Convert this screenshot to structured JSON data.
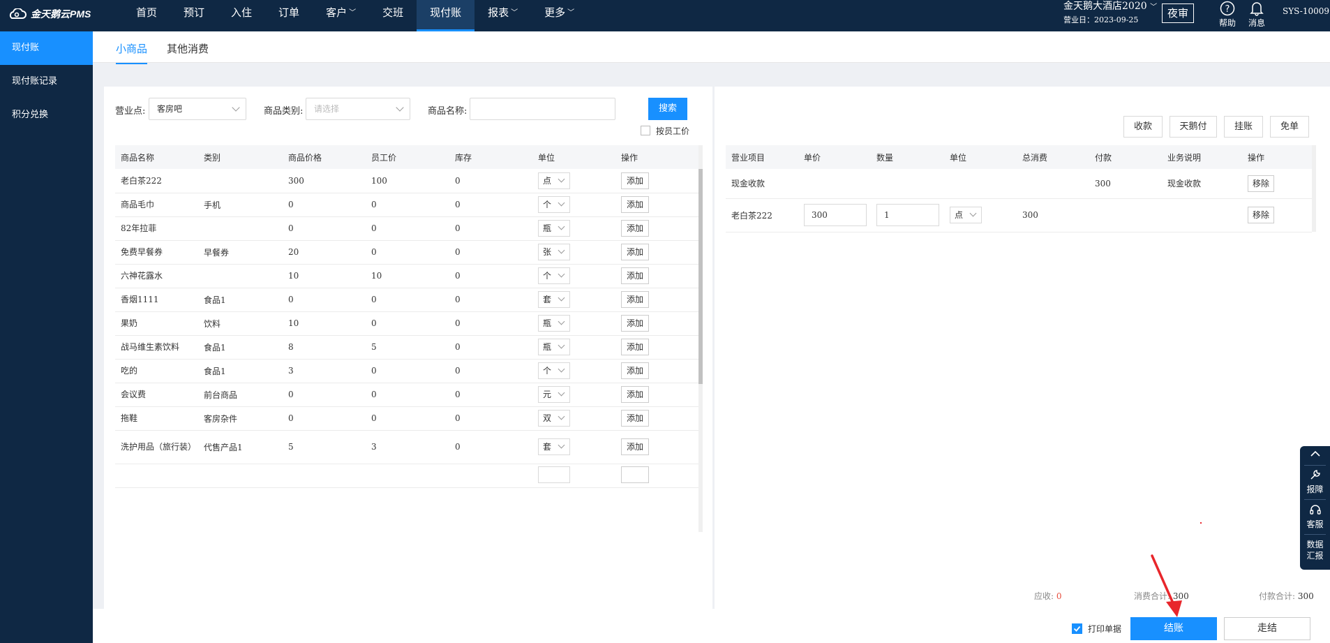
{
  "app": {
    "logo_text": "金天鹅云PMS"
  },
  "nav": [
    {
      "label": "首页",
      "dropdown": false,
      "active": false
    },
    {
      "label": "预订",
      "dropdown": false,
      "active": false
    },
    {
      "label": "入住",
      "dropdown": false,
      "active": false
    },
    {
      "label": "订单",
      "dropdown": false,
      "active": false
    },
    {
      "label": "客户",
      "dropdown": true,
      "active": false
    },
    {
      "label": "交班",
      "dropdown": false,
      "active": false
    },
    {
      "label": "现付账",
      "dropdown": false,
      "active": true
    },
    {
      "label": "报表",
      "dropdown": true,
      "active": false
    },
    {
      "label": "更多",
      "dropdown": true,
      "active": false
    }
  ],
  "header": {
    "hotel_name": "金天鹅大酒店2020",
    "business_date": "营业日：2023-09-25",
    "night_audit_label": "夜审",
    "help_label": "帮助",
    "message_label": "消息",
    "user": "SYS-10009"
  },
  "sidebar": {
    "items": [
      {
        "label": "现付账",
        "active": true
      },
      {
        "label": "现付账记录",
        "active": false
      },
      {
        "label": "积分兑换",
        "active": false
      }
    ]
  },
  "tabs": [
    {
      "label": "小商品",
      "active": true
    },
    {
      "label": "其他消费",
      "active": false
    }
  ],
  "filters": {
    "outlet_label": "营业点:",
    "outlet_value": "客房吧",
    "category_label": "商品类别:",
    "category_placeholder": "请选择",
    "name_label": "商品名称:",
    "name_value": "",
    "search_label": "搜索",
    "staff_price_label": "按员工价",
    "staff_price_checked": false
  },
  "products": {
    "columns": [
      "商品名称",
      "类别",
      "商品价格",
      "员工价",
      "库存",
      "单位",
      "操作"
    ],
    "add_label": "添加",
    "rows": [
      {
        "name": "老白茶222",
        "category": "",
        "price": "300",
        "staff_price": "100",
        "stock": "0",
        "unit": "点"
      },
      {
        "name": "商品毛巾",
        "category": "手机",
        "price": "0",
        "staff_price": "0",
        "stock": "0",
        "unit": "个"
      },
      {
        "name": "82年拉菲",
        "category": "",
        "price": "0",
        "staff_price": "0",
        "stock": "0",
        "unit": "瓶"
      },
      {
        "name": "免费早餐券",
        "category": "早餐券",
        "price": "20",
        "staff_price": "0",
        "stock": "0",
        "unit": "张"
      },
      {
        "name": "六神花露水",
        "category": "",
        "price": "10",
        "staff_price": "10",
        "stock": "0",
        "unit": "个"
      },
      {
        "name": "香烟1111",
        "category": "食品1",
        "price": "0",
        "staff_price": "0",
        "stock": "0",
        "unit": "套"
      },
      {
        "name": "果奶",
        "category": "饮料",
        "price": "10",
        "staff_price": "0",
        "stock": "0",
        "unit": "瓶"
      },
      {
        "name": "战马维生素饮料",
        "category": "食品1",
        "price": "8",
        "staff_price": "5",
        "stock": "0",
        "unit": "瓶"
      },
      {
        "name": "吃的",
        "category": "食品1",
        "price": "3",
        "staff_price": "0",
        "stock": "0",
        "unit": "个"
      },
      {
        "name": "会议费",
        "category": "前台商品",
        "price": "0",
        "staff_price": "0",
        "stock": "0",
        "unit": "元"
      },
      {
        "name": "拖鞋",
        "category": "客房杂件",
        "price": "0",
        "staff_price": "0",
        "stock": "0",
        "unit": "双"
      },
      {
        "name": "洗护用品（旅行装）",
        "category": "代售产品1",
        "price": "5",
        "staff_price": "3",
        "stock": "0",
        "unit": "套"
      }
    ]
  },
  "actions": {
    "receive_label": "收款",
    "tianepay_label": "天鹅付",
    "credit_label": "挂账",
    "waive_label": "免单"
  },
  "bill": {
    "columns": [
      "营业项目",
      "单价",
      "数量",
      "单位",
      "总消费",
      "付款",
      "业务说明",
      "操作"
    ],
    "remove_label": "移除",
    "payment_row": {
      "item": "现金收款",
      "payment": "300",
      "note": "现金收款"
    },
    "item_row": {
      "item": "老白茶222",
      "unit_price": "300",
      "qty": "1",
      "unit": "点",
      "total": "300"
    }
  },
  "summary": {
    "receivable_label": "应收:",
    "receivable_value": "0",
    "consumption_label": "消费合计:",
    "consumption_value": "300",
    "payment_label": "付款合计:",
    "payment_value": "300"
  },
  "footer": {
    "print_label": "打印单据",
    "print_checked": true,
    "checkout_label": "结账",
    "walkout_label": "走结"
  },
  "float_tools": {
    "fault_label": "报障",
    "service_label": "客服",
    "report_label_1": "数据",
    "report_label_2": "汇报"
  },
  "colors": {
    "nav_bg": "#0f2844",
    "accent": "#1890ff",
    "arrow": "#e8262b",
    "receivable": "#e74c3c"
  }
}
